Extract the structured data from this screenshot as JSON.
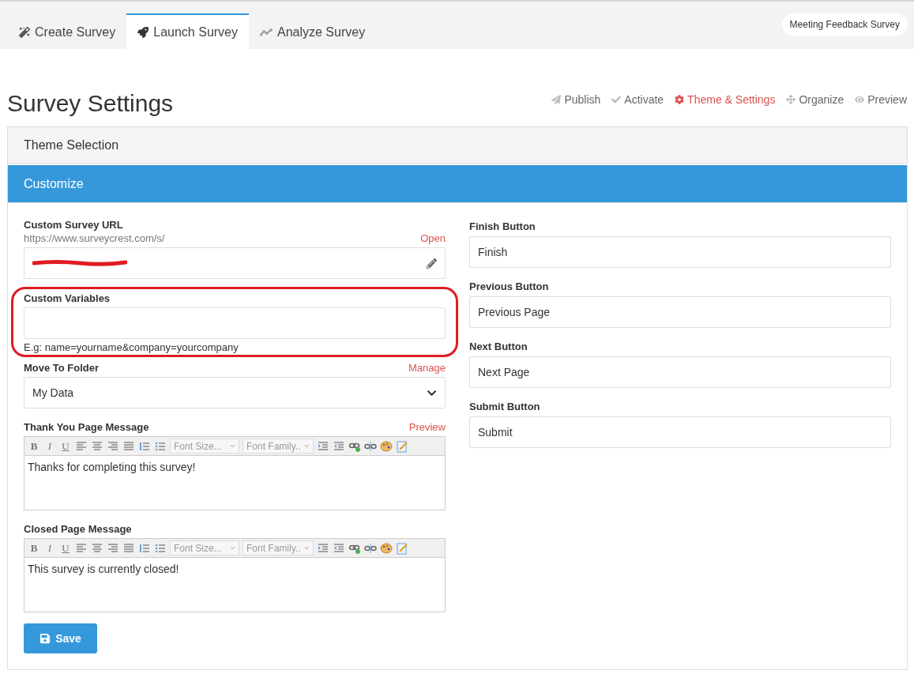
{
  "tabs": [
    {
      "label": "Create Survey",
      "selected": false
    },
    {
      "label": "Launch Survey",
      "selected": true
    },
    {
      "label": "Analyze Survey",
      "selected": false
    }
  ],
  "survey_name": "Meeting Feedback Survey",
  "page_title": "Survey Settings",
  "actions": [
    {
      "label": "Publish",
      "selected": false
    },
    {
      "label": "Activate",
      "selected": false
    },
    {
      "label": "Theme & Settings",
      "selected": true
    },
    {
      "label": "Organize",
      "selected": false
    },
    {
      "label": "Preview",
      "selected": false
    }
  ],
  "sections": [
    {
      "title": "Theme Selection",
      "expanded": false
    },
    {
      "title": "Customize",
      "expanded": true
    }
  ],
  "left_fields": [
    {
      "kind": "url",
      "label": "Custom Survey URL",
      "prefix": "https://www.surveycrest.com/s/",
      "link": "Open",
      "redacted": true
    },
    {
      "kind": "text",
      "label": "Custom Variables",
      "hint": "E.g: name=yourname&company=yourcompany",
      "highlighted": true
    },
    {
      "kind": "select",
      "label": "Move To Folder",
      "link": "Manage",
      "value": "My Data"
    },
    {
      "kind": "editor",
      "label": "Thank You Page Message",
      "link": "Preview",
      "toolbar_letters": [
        "B",
        "I",
        "U"
      ],
      "font_size": "Font Size...",
      "font_family": "Font Family..",
      "value": "Thanks for completing this survey!"
    },
    {
      "kind": "editor",
      "label": "Closed Page Message",
      "toolbar_letters": [
        "B",
        "I",
        "U"
      ],
      "font_size": "Font Size...",
      "font_family": "Font Family..",
      "value": "This survey is currently closed!"
    }
  ],
  "right_fields": [
    {
      "label": "Finish Button",
      "value": "Finish"
    },
    {
      "label": "Previous Button",
      "value": "Previous Page"
    },
    {
      "label": "Next Button",
      "value": "Next Page"
    },
    {
      "label": "Submit Button",
      "value": "Submit"
    }
  ],
  "save_button": "Save"
}
